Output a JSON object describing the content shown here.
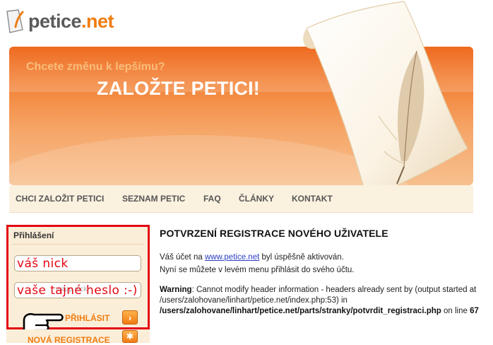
{
  "logo": {
    "text_a": "petice",
    "text_b": ".net"
  },
  "banner": {
    "subtitle": "Chcete změnu k lepšímu?",
    "title": "ZALOŽTE PETICI!"
  },
  "nav": [
    {
      "label": "CHCI ZALOŽIT PETICI"
    },
    {
      "label": "SEZNAM PETIC"
    },
    {
      "label": "FAQ"
    },
    {
      "label": "ČLÁNKY"
    },
    {
      "label": "KONTAKT"
    }
  ],
  "login": {
    "title": "Přihlášení",
    "nick_annotation": "váš nick",
    "password_annotation": "vaše tajné heslo :-)",
    "password_faint": "vstup nick",
    "submit_label": "PŘIHLÁSIT",
    "register_label": "NOVÁ REGISTRACE"
  },
  "content": {
    "heading": "POTVRZENÍ REGISTRACE NOVÉHO UŽIVATELE",
    "line1_pre": "Váš účet na ",
    "line1_link": "www.petice.net",
    "line1_post": " byl úspěšně aktivován.",
    "line2": "Nyní se můžete v levém menu přihlásit do svého účtu.",
    "warning_label": "Warning",
    "warning_text1": ": Cannot modify header information - headers already sent by (output started at /users/zalohovane/linhart/petice.net/index.php:53) in ",
    "warning_path": "/users/zalohovane/linhart/petice.net/parts/stranky/potvrdit_registraci.php",
    "warning_text2": " on line ",
    "warning_line": "67"
  },
  "colors": {
    "accent": "#ef7d14",
    "annotation_red": "#e30613",
    "link": "#2a3cc4"
  },
  "icons": {
    "arrow_button": "arrow-right-icon",
    "plus_button": "plus-icon",
    "pointer": "pointing-hand-icon"
  }
}
